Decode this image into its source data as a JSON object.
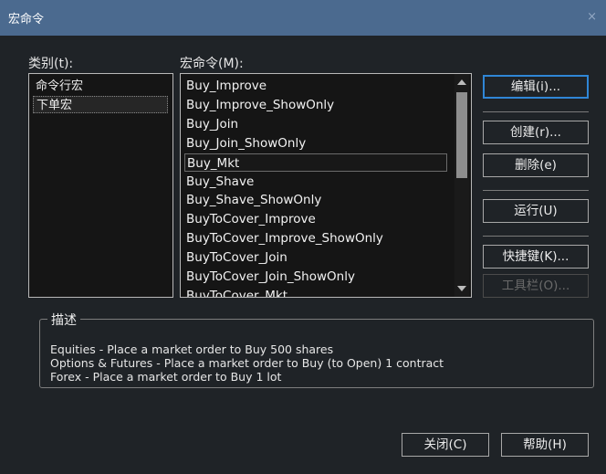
{
  "window": {
    "title": "宏命令",
    "close": "×"
  },
  "categories": {
    "label": "类别(t):",
    "items": [
      {
        "label": "命令行宏",
        "selected": false
      },
      {
        "label": "下单宏",
        "selected": true
      }
    ]
  },
  "macros": {
    "label": "宏命令(M):",
    "items": [
      {
        "label": "Buy_Improve",
        "selected": false
      },
      {
        "label": "Buy_Improve_ShowOnly",
        "selected": false
      },
      {
        "label": "Buy_Join",
        "selected": false
      },
      {
        "label": "Buy_Join_ShowOnly",
        "selected": false
      },
      {
        "label": "Buy_Mkt",
        "selected": true
      },
      {
        "label": "Buy_Shave",
        "selected": false
      },
      {
        "label": "Buy_Shave_ShowOnly",
        "selected": false
      },
      {
        "label": "BuyToCover_Improve",
        "selected": false
      },
      {
        "label": "BuyToCover_Improve_ShowOnly",
        "selected": false
      },
      {
        "label": "BuyToCover_Join",
        "selected": false
      },
      {
        "label": "BuyToCover_Join_ShowOnly",
        "selected": false
      },
      {
        "label": "BuyToCover_Mkt",
        "selected": false
      }
    ]
  },
  "buttons": {
    "edit": "编辑(i)...",
    "create": "创建(r)...",
    "delete": "删除(e)",
    "run": "运行(U)",
    "shortcut": "快捷键(K)...",
    "toolbar": "工具栏(O)...",
    "close": "关闭(C)",
    "help": "帮助(H)"
  },
  "description": {
    "title": "描述",
    "lines": [
      "Equities - Place a market order to Buy 500 shares",
      "Options & Futures - Place a market order to Buy (to Open) 1 contract",
      "Forex - Place a market order to Buy 1 lot"
    ]
  },
  "colors": {
    "titlebar": "#4b6a8f",
    "accent": "#2f86d6",
    "background": "#1f2327"
  }
}
